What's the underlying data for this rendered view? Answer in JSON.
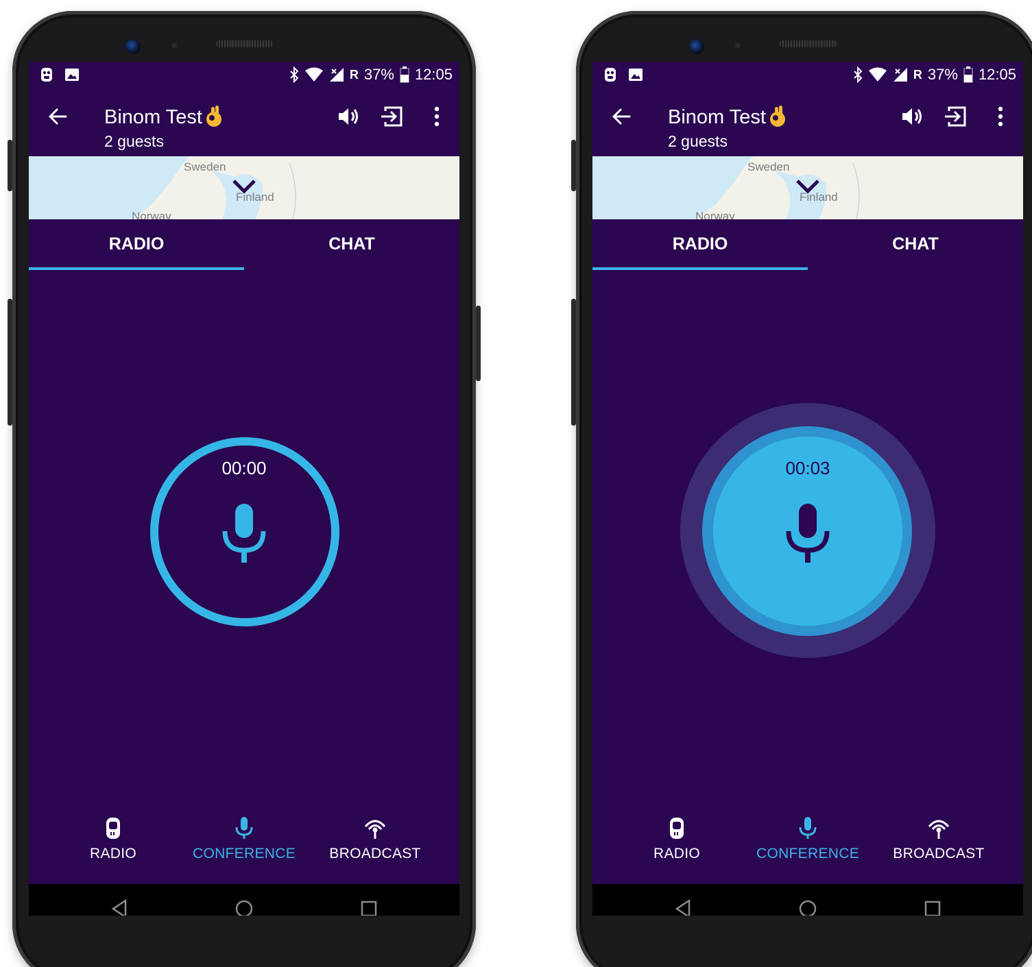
{
  "colors": {
    "app_bg": "#2a0750",
    "accent": "#36b6e7",
    "accent_dark": "#2f93cf",
    "halo": "#3b2c73",
    "map_water": "#cfe9f7"
  },
  "screens": [
    {
      "status": {
        "bluetooth": "bluetooth-icon",
        "wifi": "wifi-icon",
        "signal": "signal-icon",
        "roaming": "R",
        "battery": "37%",
        "time": "12:05"
      },
      "appbar": {
        "title": "Binom Test",
        "subtitle": "2 guests"
      },
      "map": {
        "label_sweden": "Sweden",
        "label_finland": "Finland",
        "label_norway": "Norway"
      },
      "tabs": [
        {
          "label": "RADIO"
        },
        {
          "label": "CHAT"
        }
      ],
      "ptt": {
        "timer": "00:00",
        "state": "idle"
      },
      "bottom_nav": [
        {
          "label": "RADIO"
        },
        {
          "label": "CONFERENCE"
        },
        {
          "label": "BROADCAST"
        }
      ]
    },
    {
      "status": {
        "bluetooth": "bluetooth-icon",
        "wifi": "wifi-icon",
        "signal": "signal-icon",
        "roaming": "R",
        "battery": "37%",
        "time": "12:05"
      },
      "appbar": {
        "title": "Binom Test",
        "subtitle": "2 guests"
      },
      "map": {
        "label_sweden": "Sweden",
        "label_finland": "Finland",
        "label_norway": "Norway"
      },
      "tabs": [
        {
          "label": "RADIO"
        },
        {
          "label": "CHAT"
        }
      ],
      "ptt": {
        "timer": "00:03",
        "state": "transmitting"
      },
      "bottom_nav": [
        {
          "label": "RADIO"
        },
        {
          "label": "CONFERENCE"
        },
        {
          "label": "BROADCAST"
        }
      ]
    }
  ]
}
